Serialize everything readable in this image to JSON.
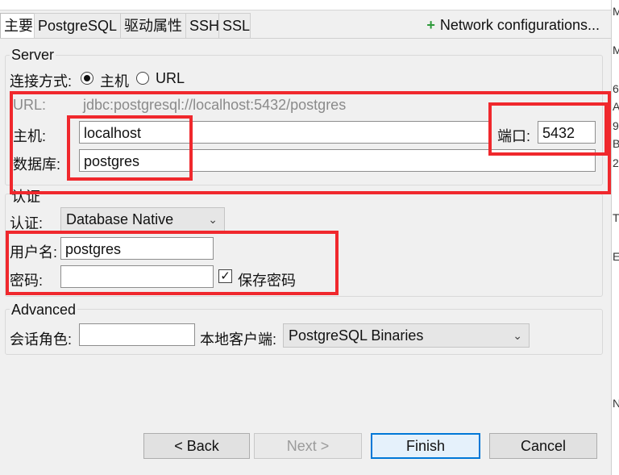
{
  "tabs": {
    "main": "主要",
    "postgresql": "PostgreSQL",
    "driver": "驱动属性",
    "ssh": "SSH",
    "ssl": "SSL",
    "network": "Network configurations..."
  },
  "server": {
    "title": "Server",
    "connect_label": "连接方式:",
    "radio_host": "主机",
    "radio_url": "URL",
    "url_label": "URL:",
    "url_value": "jdbc:postgresql://localhost:5432/postgres",
    "host_label": "主机:",
    "host_value": "localhost",
    "port_label": "端口:",
    "port_value": "5432",
    "db_label": "数据库:",
    "db_value": "postgres"
  },
  "auth": {
    "title": "认证",
    "auth_label": "认证:",
    "auth_value": "Database Native",
    "user_label": "用户名:",
    "user_value": "postgres",
    "password_label": "密码:",
    "password_value": "",
    "save_password": "保存密码"
  },
  "advanced": {
    "title": "Advanced",
    "role_label": "会话角色:",
    "role_value": "",
    "client_label": "本地客户端:",
    "client_value": "PostgreSQL Binaries"
  },
  "buttons": {
    "back": "< Back",
    "next": "Next >",
    "finish": "Finish",
    "cancel": "Cancel"
  },
  "right_panel_letters": [
    "M",
    "M",
    "6",
    "A",
    "9",
    "B",
    "2",
    "T",
    "E",
    "N"
  ],
  "colors": {
    "highlight_red": "#f0282d",
    "accent_blue": "#0078d7",
    "plus_green": "#2e9a3a"
  }
}
